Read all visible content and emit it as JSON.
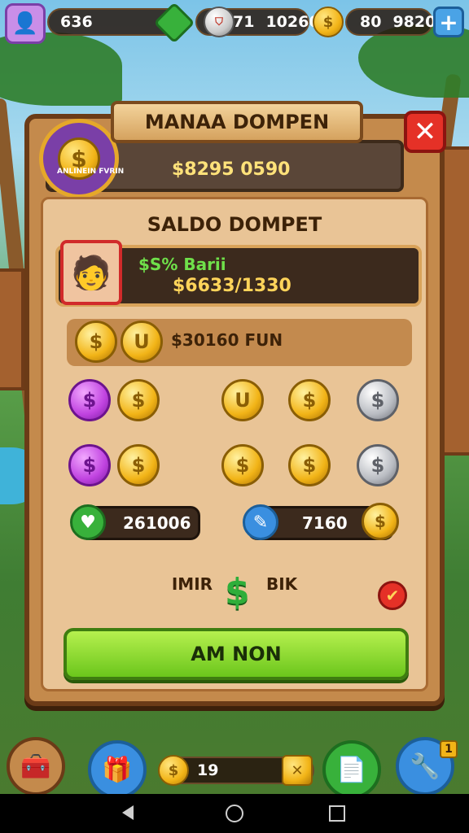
{
  "topbar": {
    "level": "636",
    "stat_center": "71",
    "stat_center_alt": "10260",
    "coins_label": "80",
    "coins_value": "9820",
    "plus_label": "+"
  },
  "dialog": {
    "title": "MANAA DOMPEN",
    "close_label": "✕",
    "badge_text": "ANLINEIN FVRIN",
    "header_amount": "$8295 0590",
    "section_title": "SALDO DOMPET",
    "player_name": "$S% Barii",
    "player_amount": "$6633/1330",
    "fund_label": "$30160 FUN",
    "counter_left": "261006",
    "counter_right": "7160",
    "bik_label_left": "IMIR",
    "bik_label_right": "BIK",
    "check_label": "✔",
    "confirm_label": "AM NON"
  },
  "coins": {
    "row1": [
      "purple",
      "gold",
      "gold",
      "gold",
      "silver"
    ],
    "row2": [
      "purple",
      "gold",
      "gold",
      "gold",
      "silver"
    ],
    "symbol_dollar": "$",
    "symbol_u": "U"
  },
  "bottombar": {
    "center_value": "19",
    "notif_badge": "1"
  },
  "colors": {
    "panel_wood": "#c48a4c",
    "confirm_green": "#6bc61c",
    "close_red": "#e53127",
    "gold": "#f2b417",
    "purple": "#c043e0"
  }
}
